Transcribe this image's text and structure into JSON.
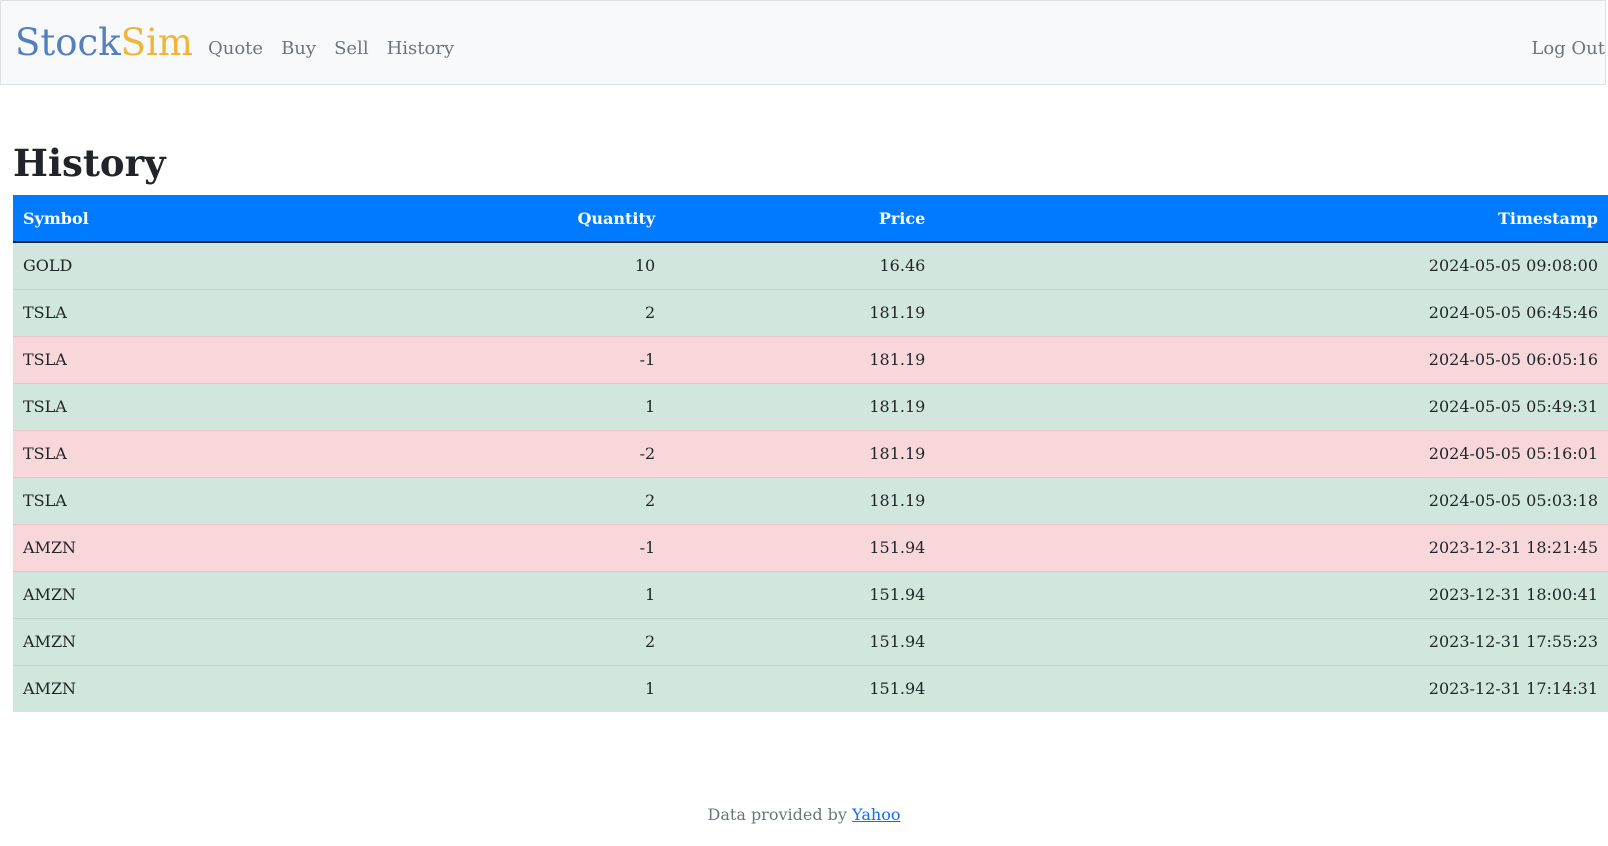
{
  "navbar": {
    "brand_part1": "Stock",
    "brand_part2": "Sim",
    "brand_color1": "#537fbe",
    "brand_color2": "#f0b43b",
    "links": [
      {
        "label": "Quote"
      },
      {
        "label": "Buy"
      },
      {
        "label": "Sell"
      },
      {
        "label": "History"
      }
    ],
    "logout_label": "Log Out"
  },
  "page": {
    "title": "History"
  },
  "table": {
    "headers": {
      "symbol": "Symbol",
      "quantity": "Quantity",
      "price": "Price",
      "timestamp": "Timestamp"
    },
    "header_color": "#007bff",
    "buy_row_color": "#d1e7dd",
    "sell_row_color": "#f8d7da",
    "rows": [
      {
        "symbol": "GOLD",
        "quantity": "10",
        "price": "16.46",
        "timestamp": "2024-05-05 09:08:00"
      },
      {
        "symbol": "TSLA",
        "quantity": "2",
        "price": "181.19",
        "timestamp": "2024-05-05 06:45:46"
      },
      {
        "symbol": "TSLA",
        "quantity": "-1",
        "price": "181.19",
        "timestamp": "2024-05-05 06:05:16"
      },
      {
        "symbol": "TSLA",
        "quantity": "1",
        "price": "181.19",
        "timestamp": "2024-05-05 05:49:31"
      },
      {
        "symbol": "TSLA",
        "quantity": "-2",
        "price": "181.19",
        "timestamp": "2024-05-05 05:16:01"
      },
      {
        "symbol": "TSLA",
        "quantity": "2",
        "price": "181.19",
        "timestamp": "2024-05-05 05:03:18"
      },
      {
        "symbol": "AMZN",
        "quantity": "-1",
        "price": "151.94",
        "timestamp": "2023-12-31 18:21:45"
      },
      {
        "symbol": "AMZN",
        "quantity": "1",
        "price": "151.94",
        "timestamp": "2023-12-31 18:00:41"
      },
      {
        "symbol": "AMZN",
        "quantity": "2",
        "price": "151.94",
        "timestamp": "2023-12-31 17:55:23"
      },
      {
        "symbol": "AMZN",
        "quantity": "1",
        "price": "151.94",
        "timestamp": "2023-12-31 17:14:31"
      }
    ]
  },
  "footer": {
    "text": "Data provided by ",
    "link_label": "Yahoo"
  }
}
